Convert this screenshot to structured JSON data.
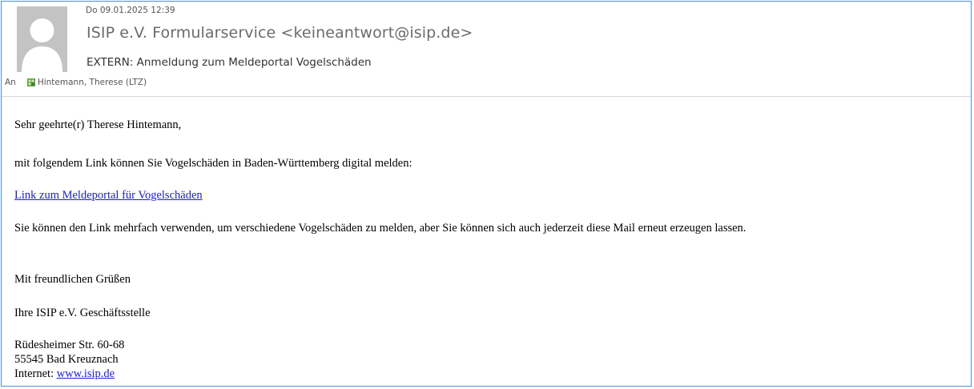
{
  "email": {
    "datetime": "Do 09.01.2025 12:39",
    "sender": "ISIP e.V. Formularservice <keineantwort@isip.de>",
    "subject": "EXTERN: Anmeldung zum Meldeportal Vogelschäden",
    "to_label": "An",
    "recipient": "Hintemann, Therese (LTZ)",
    "avatar_icon": "person-placeholder-icon",
    "contact_icon": "contact-card-icon"
  },
  "body": {
    "greeting": "Sehr geehrte(r) Therese Hintemann,",
    "intro": "mit folgendem Link können Sie Vogelschäden in Baden-Württemberg digital melden:",
    "link_text": "Link zum Meldeportal für Vogelschäden",
    "info": "Sie können den Link mehrfach verwenden, um verschiedene Vogelschäden zu melden, aber Sie können sich auch jederzeit diese Mail erneut erzeugen lassen.",
    "closing": "Mit freundlichen Grüßen",
    "signature": "Ihre ISIP e.V. Geschäftsstelle",
    "address_street": "Rüdesheimer Str. 60-68",
    "address_city": "55545 Bad Kreuznach",
    "web_label": "Internet: ",
    "web_link": "www.isip.de"
  },
  "colors": {
    "frame_border": "#4a90d9",
    "link": "#1a1adb",
    "avatar_bg": "#c3c3c3"
  }
}
